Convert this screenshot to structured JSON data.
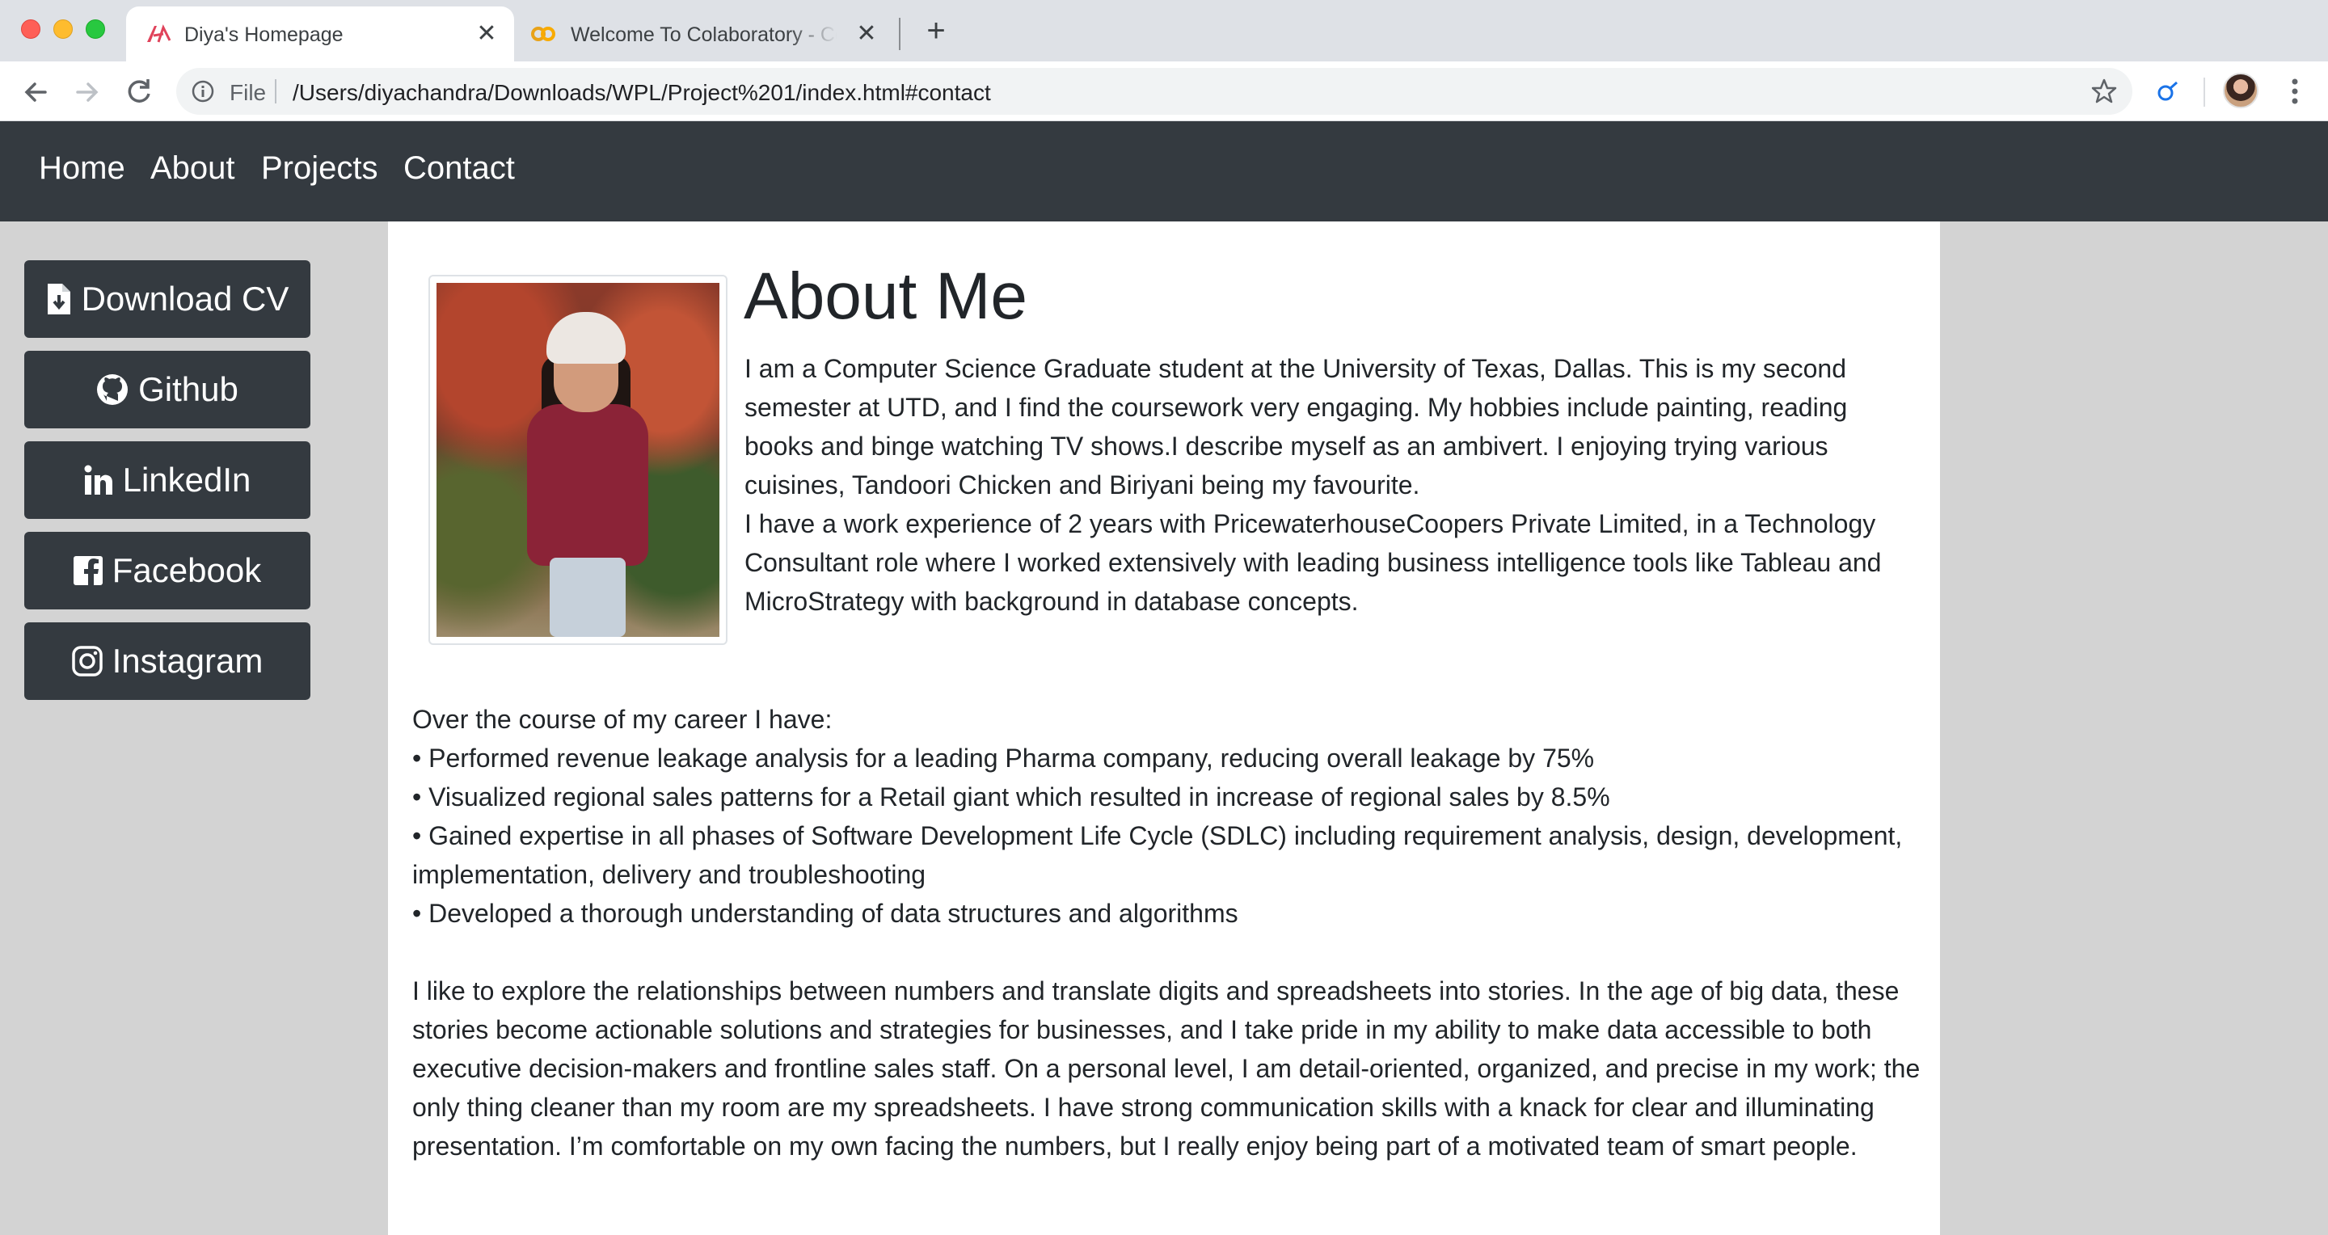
{
  "browser": {
    "tabs": [
      {
        "title": "Diya's Homepage",
        "active": true,
        "favicon": "ai-favicon-icon"
      },
      {
        "title": "Welcome To Colaboratory - Colaboratory",
        "active": false,
        "favicon": "colab-favicon-icon"
      }
    ],
    "address": {
      "scheme_label": "File",
      "url": "/Users/diyachandra/Downloads/WPL/Project%201/index.html#contact"
    },
    "colors": {
      "tabstrip": "#dee1e6",
      "toolbar": "#ffffff",
      "omnibox": "#f1f3f4"
    }
  },
  "nav": {
    "items": [
      "Home",
      "About",
      "Projects",
      "Contact"
    ],
    "background": "#343a40"
  },
  "sidebar": {
    "buttons": [
      {
        "label": "Download CV",
        "icon": "file-download-icon"
      },
      {
        "label": "Github",
        "icon": "github-icon"
      },
      {
        "label": "LinkedIn",
        "icon": "linkedin-icon"
      },
      {
        "label": "Facebook",
        "icon": "facebook-icon"
      },
      {
        "label": "Instagram",
        "icon": "instagram-icon"
      }
    ],
    "button_color": "#343a40"
  },
  "about": {
    "title": "About Me",
    "intro_lines": [
      "I am a Computer Science Graduate student at the University of Texas, Dallas. This is my second semester at UTD, and I find the coursework very engaging. My hobbies include painting, reading books and binge watching TV shows.I describe myself as an ambivert. I enjoying trying various cuisines, Tandoori Chicken and Biriyani being my favourite.",
      "I have a work experience of 2 years with PricewaterhouseCoopers Private Limited, in a Technology Consultant role where I worked extensively with leading business intelligence tools like Tableau and MicroStrategy with background in database concepts."
    ],
    "career_intro": "Over the course of my career I have:",
    "career_points": [
      "• Performed revenue leakage analysis for a leading Pharma company, reducing overall leakage by 75%",
      "• Visualized regional sales patterns for a Retail giant which resulted in increase of regional sales by 8.5%",
      "• Gained expertise in all phases of Software Development Life Cycle (SDLC) including requirement analysis, design, development, implementation, delivery and troubleshooting",
      "• Developed a thorough understanding of data structures and algorithms"
    ],
    "closing": "I like to explore the relationships between numbers and translate digits and spreadsheets into stories. In the age of big data, these stories become actionable solutions and strategies for businesses, and I take pride in my ability to make data accessible to both executive decision-makers and frontline sales staff. On a personal level, I am detail-oriented, organized, and precise in my work; the only thing cleaner than my room are my spreadsheets. I have strong communication skills with a knack for clear and illuminating presentation. I’m comfortable on my own facing the numbers, but I really enjoy being part of a motivated team of smart people."
  }
}
